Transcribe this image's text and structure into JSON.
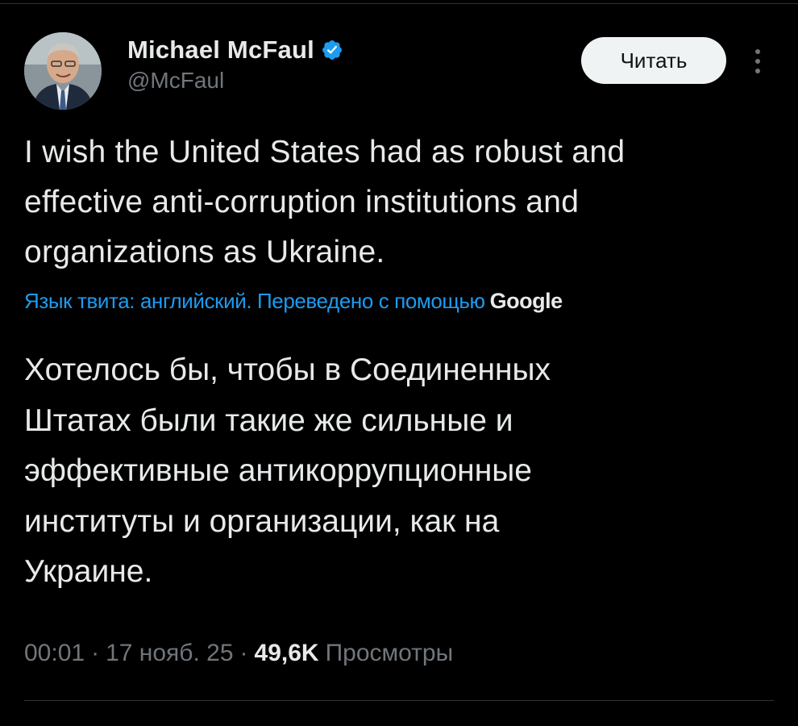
{
  "author": {
    "display_name": "Michael McFaul",
    "handle": "@McFaul",
    "verified": true,
    "verified_color": "#1d9bf0",
    "avatar_icon": "profile-photo"
  },
  "follow_button": {
    "label": "Читать"
  },
  "more_menu": {
    "icon": "more-vertical-icon"
  },
  "tweet": {
    "text": "I wish the United States had as robust and\neffective anti-corruption institutions and\norganizations as Ukraine."
  },
  "translation": {
    "note": "Язык твита: английский. Переведено с помощью",
    "provider": "Google",
    "text": "Хотелось бы, чтобы в Соединенных\nШтатах были такие же сильные и\nэффективные антикоррупционные\nинституты и организации, как на\nУкраине."
  },
  "meta": {
    "time": "00:01",
    "separator": "·",
    "date": "17 нояб. 25",
    "views_count": "49,6K",
    "views_label": "Просмотры"
  },
  "colors": {
    "background": "#000000",
    "text_primary": "#e7e9ea",
    "text_secondary": "#71767b",
    "accent": "#1d9bf0"
  }
}
